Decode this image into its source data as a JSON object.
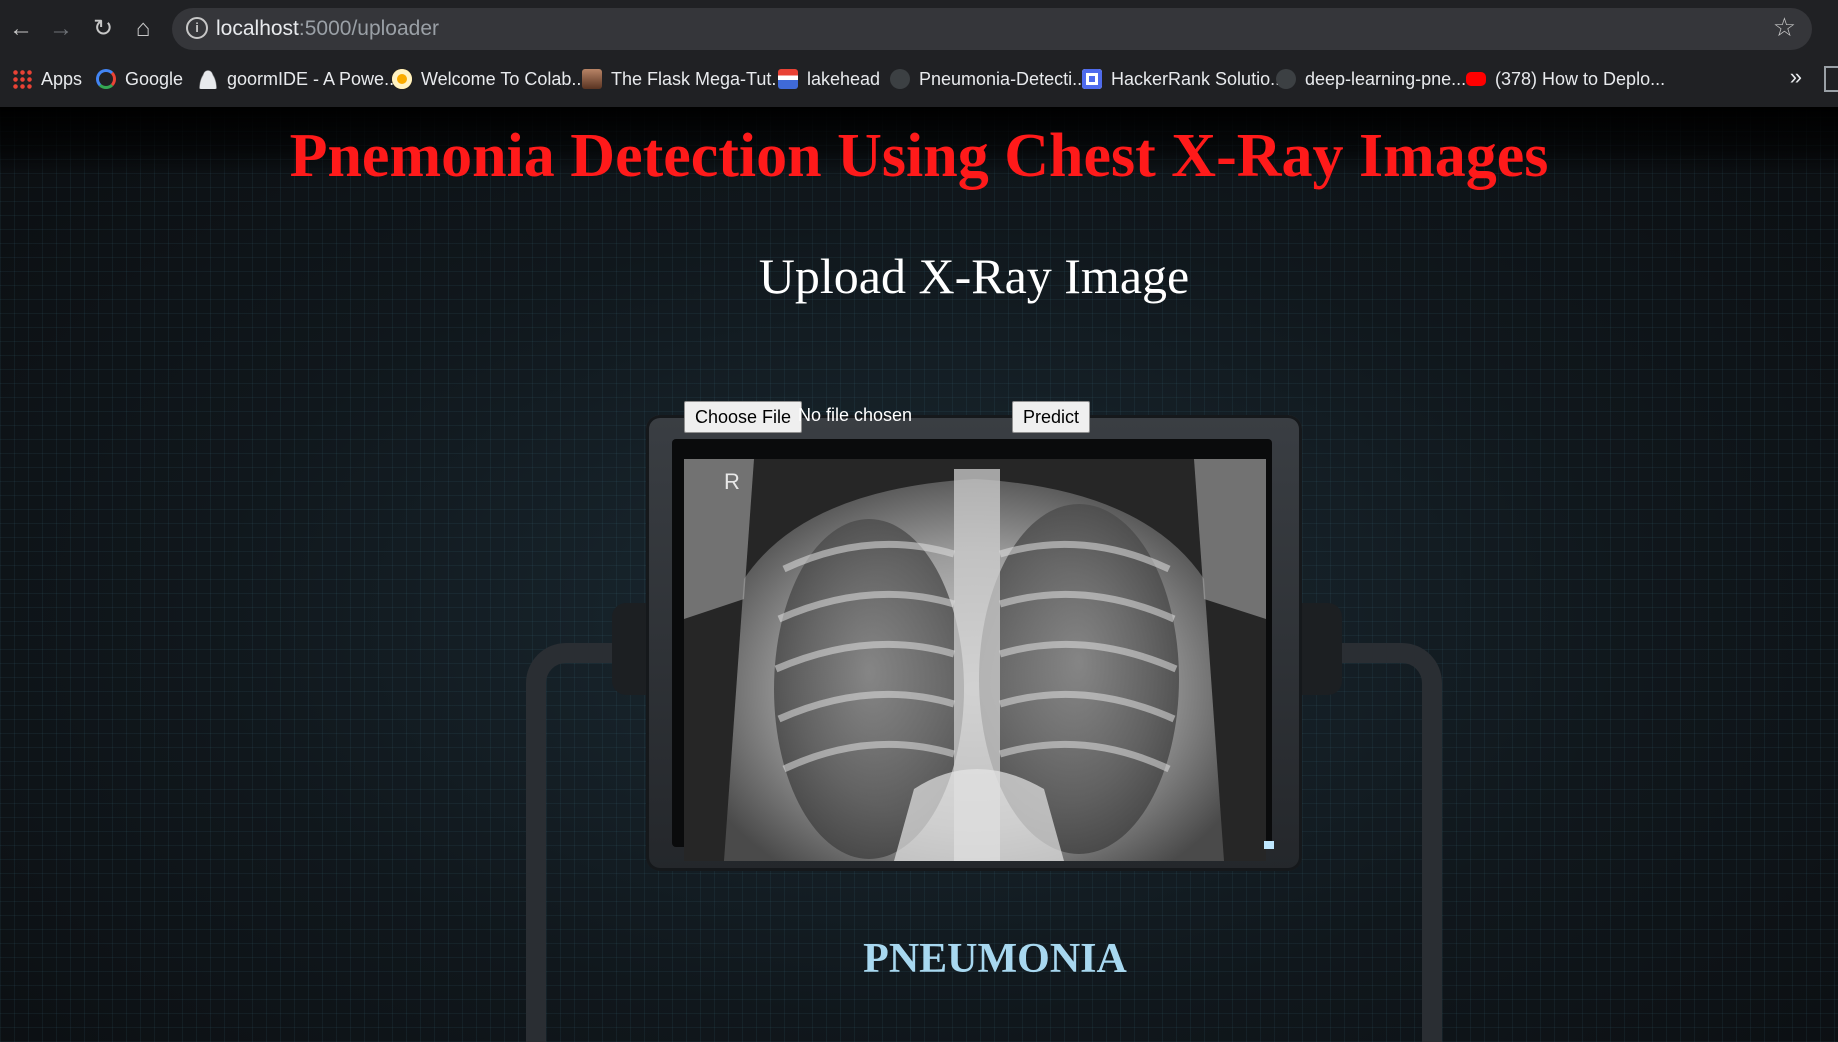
{
  "browser": {
    "url_host": "localhost",
    "url_path": ":5000/uploader",
    "bookmarks": [
      {
        "label": "Apps",
        "color": "#e94235"
      },
      {
        "label": "Google",
        "color": "#4285f4"
      },
      {
        "label": "goormIDE - A Powe...",
        "color": "#e8eaed"
      },
      {
        "label": "Welcome To Colab...",
        "color": "#f9ab00"
      },
      {
        "label": "The Flask Mega-Tut...",
        "color": "#8b5a3c"
      },
      {
        "label": "lakehead",
        "color": "#3f6ad8"
      },
      {
        "label": "Pneumonia-Detecti...",
        "color": "#5f6368"
      },
      {
        "label": "HackerRank Solutio...",
        "color": "#4f6bed"
      },
      {
        "label": "deep-learning-pne...",
        "color": "#5f6368"
      },
      {
        "label": "(378) How to Deplo...",
        "color": "#ff0000"
      }
    ],
    "more_label": "»"
  },
  "page": {
    "title": "Pnemonia Detection Using Chest X-Ray Images",
    "subtitle": "Upload X-Ray Image",
    "choose_file_label": "Choose File",
    "no_file_label": "No file chosen",
    "predict_label": "Predict",
    "xray_marker": "R",
    "result": "PNEUMONIA"
  },
  "colors": {
    "title": "#ff1a1a",
    "result": "#a8d8f0"
  }
}
